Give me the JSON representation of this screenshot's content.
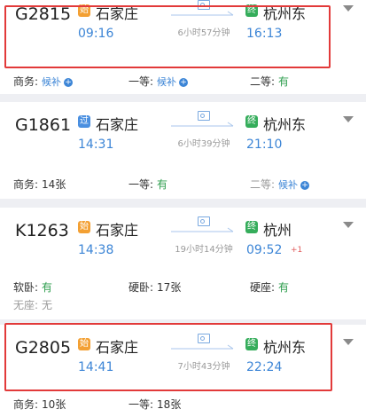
{
  "colors": {
    "accent_blue": "#3c85d6",
    "available_green": "#2e9e4e",
    "highlight_red": "#e23a3a",
    "badge_orange": "#f3a033",
    "badge_blue": "#4a8fe0",
    "badge_green": "#35ad5b"
  },
  "trains": [
    {
      "train_no": "G2815",
      "from_badge": "始",
      "from_badge_color": "#f3a033",
      "from": "石家庄",
      "dep_time": "09:16",
      "duration": "6小时57分钟",
      "to_badge": "终",
      "to": "杭州东",
      "arr_time": "16:13",
      "plus_day": "",
      "seats": [
        {
          "label": "商务:",
          "value": "候补",
          "style": "blue",
          "plus": true
        },
        {
          "label": "一等:",
          "value": "候补",
          "style": "blue",
          "plus": true
        },
        {
          "label": "二等:",
          "value": "有",
          "style": "green",
          "plus": false
        }
      ]
    },
    {
      "train_no": "G1861",
      "from_badge": "过",
      "from_badge_color": "#4a8fe0",
      "from": "石家庄",
      "dep_time": "14:31",
      "duration": "6小时39分钟",
      "to_badge": "终",
      "to": "杭州东",
      "arr_time": "21:10",
      "plus_day": "",
      "seats": [
        {
          "label": "商务:",
          "value": "14张",
          "style": "plain",
          "plus": false
        },
        {
          "label": "一等:",
          "value": "有",
          "style": "green",
          "plus": false
        },
        {
          "label": "二等:",
          "value": "候补",
          "style": "blue",
          "plus": true
        }
      ]
    },
    {
      "train_no": "K1263",
      "from_badge": "始",
      "from_badge_color": "#f3a033",
      "from": "石家庄",
      "dep_time": "14:38",
      "duration": "19小时14分钟",
      "to_badge": "终",
      "to": "杭州",
      "arr_time": "09:52",
      "plus_day": "+1",
      "seats": [
        {
          "label": "软卧:",
          "value": "有",
          "style": "green",
          "plus": false
        },
        {
          "label": "硬卧:",
          "value": "17张",
          "style": "plain",
          "plus": false
        },
        {
          "label": "硬座:",
          "value": "有",
          "style": "green",
          "plus": false
        },
        {
          "label": "无座:",
          "value": "无",
          "style": "gray",
          "plus": false
        }
      ]
    },
    {
      "train_no": "G2805",
      "from_badge": "始",
      "from_badge_color": "#f3a033",
      "from": "石家庄",
      "dep_time": "14:41",
      "duration": "7小时43分钟",
      "to_badge": "终",
      "to": "杭州东",
      "arr_time": "22:24",
      "plus_day": "",
      "seats": [
        {
          "label": "商务:",
          "value": "10张",
          "style": "plain",
          "plus": false
        },
        {
          "label": "一等:",
          "value": "18张",
          "style": "plain",
          "plus": false
        }
      ]
    }
  ]
}
